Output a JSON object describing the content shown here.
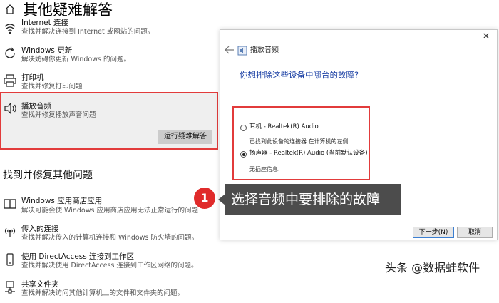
{
  "page": {
    "title": "其他疑难解答"
  },
  "items_top": [
    {
      "name": "internet",
      "title": "Internet 连接",
      "desc": "查找并解决连接到 Internet 或网站的问题。",
      "icon": "wifi-icon"
    },
    {
      "name": "windows-update",
      "title": "Windows 更新",
      "desc": "解决妨碍你更新 Windows 的问题。",
      "icon": "refresh-icon"
    },
    {
      "name": "printer",
      "title": "打印机",
      "desc": "查找并修复打印问题",
      "icon": "printer-icon"
    },
    {
      "name": "audio",
      "title": "播放音频",
      "desc": "查找并修复播放声音问题",
      "icon": "speaker-icon",
      "button": "运行疑难解答"
    }
  ],
  "section": {
    "title": "找到并修复其他问题"
  },
  "items_bottom": [
    {
      "name": "store-apps",
      "title": "Windows 应用商店应用",
      "desc": "解决可能会使 Windows 应用商店应用无法正常运行的问题",
      "icon": "window-icon"
    },
    {
      "name": "incoming",
      "title": "传入的连接",
      "desc": "查找并解决传入的计算机连接和 Windows 防火墙的问题。",
      "icon": "antenna-icon"
    },
    {
      "name": "directaccess",
      "title": "使用 DirectAccess 连接到工作区",
      "desc": "查找并解决使用 DirectAccess 连接到工作区网络的问题。",
      "icon": "phone-icon"
    },
    {
      "name": "shared-folders",
      "title": "共享文件夹",
      "desc": "查找并解决访问其他计算机上的文件和文件夹的问题。",
      "icon": "network-drive-icon"
    }
  ],
  "dialog": {
    "close": "✕",
    "title": "播放音频",
    "question": "你想排除这些设备中哪台的故障?",
    "options": [
      {
        "label": "耳机 - Realtek(R) Audio",
        "desc": "已找到此设备的连接器 在计算机的左侧.",
        "checked": false
      },
      {
        "label": "扬声器 - Realtek(R) Audio (当前默认设备)",
        "desc": "无插座信息.",
        "checked": true
      }
    ],
    "next": "下一步(N)",
    "cancel": "取消"
  },
  "callout": {
    "number": "1",
    "text": "选择音频中要排除的故障"
  },
  "watermark": "头条 @数据蛙软件",
  "colors": {
    "highlight": "#e23b3b",
    "callout_bg": "#4c4c4c",
    "question": "#1a3fa4"
  }
}
